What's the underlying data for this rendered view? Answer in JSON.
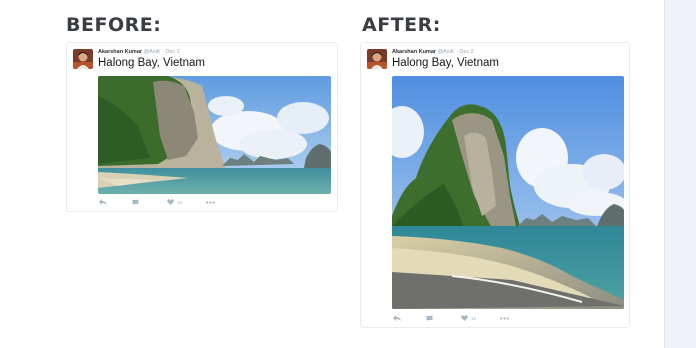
{
  "comparison": {
    "before_label": "BEFORE:",
    "after_label": "AFTER:"
  },
  "tweet": {
    "author_name": "Akarshan Kumar",
    "handle_date": "@AsiK · Dec 2",
    "text": "Halong Bay, Vietnam",
    "like_count": "10",
    "retweet_count": ""
  },
  "icons": {
    "reply": "reply-icon",
    "retweet": "retweet-icon",
    "like": "heart-icon",
    "more": "more-icon",
    "avatar": "avatar"
  },
  "colors": {
    "heading": "#3a3d42",
    "icon": "#aab8c2",
    "sky": "#79aee4",
    "sea": "#2f8a9a"
  }
}
